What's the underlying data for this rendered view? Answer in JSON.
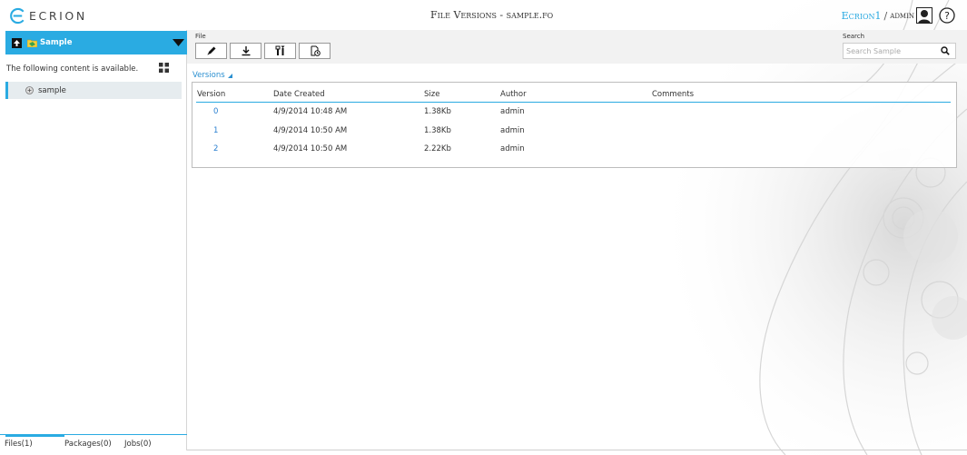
{
  "header": {
    "logo_text": "ECRION",
    "title": "File Versions - sample.fo",
    "user_name": "Ecrion1",
    "user_sep": "/",
    "user_role": "admin",
    "accent_color": "#2aabe2"
  },
  "left_panel": {
    "folder_title": "Sample",
    "available_text": "The following content is available.",
    "items": [
      {
        "label": "sample",
        "icon": "file-icon"
      }
    ],
    "tabs": {
      "files": "Files(1)",
      "packages": "Packages(0)",
      "jobs": "Jobs(0)"
    }
  },
  "toolbar": {
    "group_label": "File",
    "buttons": [
      {
        "name": "edit",
        "icon": "pencil-icon"
      },
      {
        "name": "download",
        "icon": "download-icon"
      },
      {
        "name": "tools",
        "icon": "tools-icon"
      },
      {
        "name": "history",
        "icon": "history-icon"
      }
    ],
    "search_label": "Search",
    "search_placeholder": "Search Sample"
  },
  "versions": {
    "link_label": "Versions",
    "columns": {
      "version": "Version",
      "date": "Date Created",
      "size": "Size",
      "author": "Author",
      "comments": "Comments"
    },
    "rows": [
      {
        "version": "0",
        "date": "4/9/2014 10:48 AM",
        "size": "1.38Kb",
        "author": "admin",
        "comments": ""
      },
      {
        "version": "1",
        "date": "4/9/2014 10:50 AM",
        "size": "1.38Kb",
        "author": "admin",
        "comments": ""
      },
      {
        "version": "2",
        "date": "4/9/2014 10:50 AM",
        "size": "2.22Kb",
        "author": "admin",
        "comments": ""
      }
    ]
  }
}
